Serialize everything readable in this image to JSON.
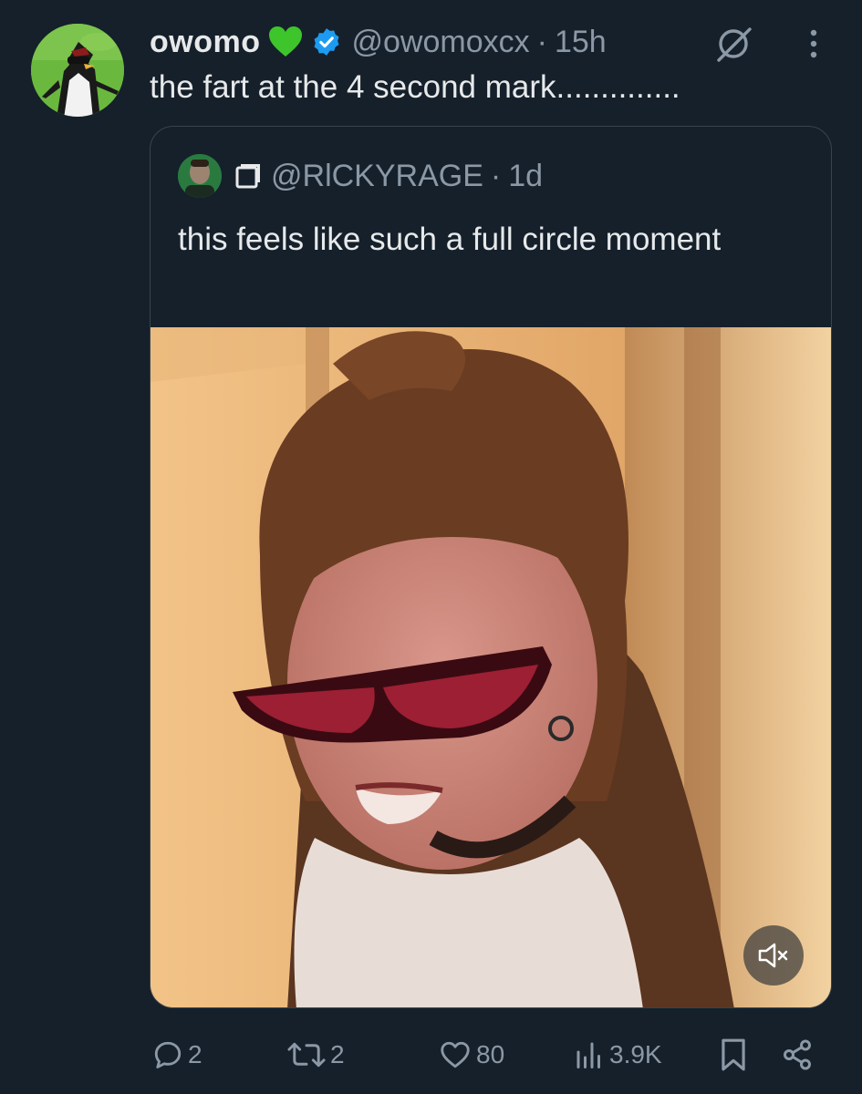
{
  "tweet": {
    "display_name": "owomo",
    "handle": "@owomoxcx",
    "dot": "·",
    "time": "15h",
    "text": "the fart at the 4 second mark..............",
    "icons": {
      "heart": "green-heart-icon",
      "verified": "verified-badge-icon",
      "grok": "grok-icon",
      "more": "more-icon"
    }
  },
  "quote": {
    "handle": "@RlCKYRAGE",
    "dot": "·",
    "time": "1d",
    "text": "this feels like such a full circle moment",
    "media_controls": {
      "mute_icon": "volume-muted-icon"
    }
  },
  "actions": {
    "replies": "2",
    "reposts": "2",
    "likes": "80",
    "views": "3.9K"
  },
  "colors": {
    "background": "#15202b",
    "text": "#e7e9ea",
    "secondary": "#8b98a5",
    "verified": "#1d9bf0",
    "heart": "#3ec52b",
    "border": "#38444d"
  }
}
